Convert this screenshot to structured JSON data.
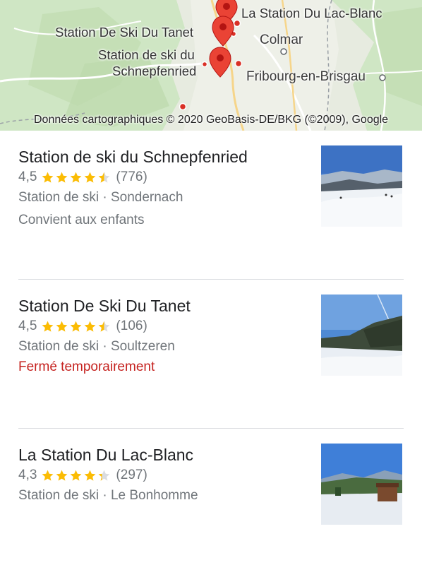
{
  "map": {
    "labels": {
      "lac_blanc": "La Station Du Lac-Blanc",
      "tanet": "Station De Ski Du Tanet",
      "schnepf_line1": "Station de ski du",
      "schnepf_line2": "Schnepfenried",
      "colmar": "Colmar",
      "fribourg": "Fribourg-en-Brisgau"
    },
    "attribution": "Données cartographiques © 2020 GeoBasis-DE/BKG (©2009), Google",
    "pin_color": "#ea4335",
    "marker_icon": "map-pin-icon"
  },
  "results": [
    {
      "title": "Station de ski du Schnepfenried",
      "rating": "4,5",
      "stars": 4.5,
      "reviews": "(776)",
      "category": "Station de ski · Sondernach",
      "extra": "Convient aux enfants",
      "extra_status": "neutral"
    },
    {
      "title": "Station De Ski Du Tanet",
      "rating": "4,5",
      "stars": 4.5,
      "reviews": "(106)",
      "category": "Station de ski · Soultzeren",
      "extra": "Fermé temporairement",
      "extra_status": "closed"
    },
    {
      "title": "La Station Du Lac-Blanc",
      "rating": "4,3",
      "stars": 4.3,
      "reviews": "(297)",
      "category": "Station de ski · Le Bonhomme",
      "extra": "",
      "extra_status": "neutral"
    }
  ],
  "colors": {
    "star": "#fbbc04",
    "closed": "#c5221f",
    "secondary_text": "#70757a"
  }
}
